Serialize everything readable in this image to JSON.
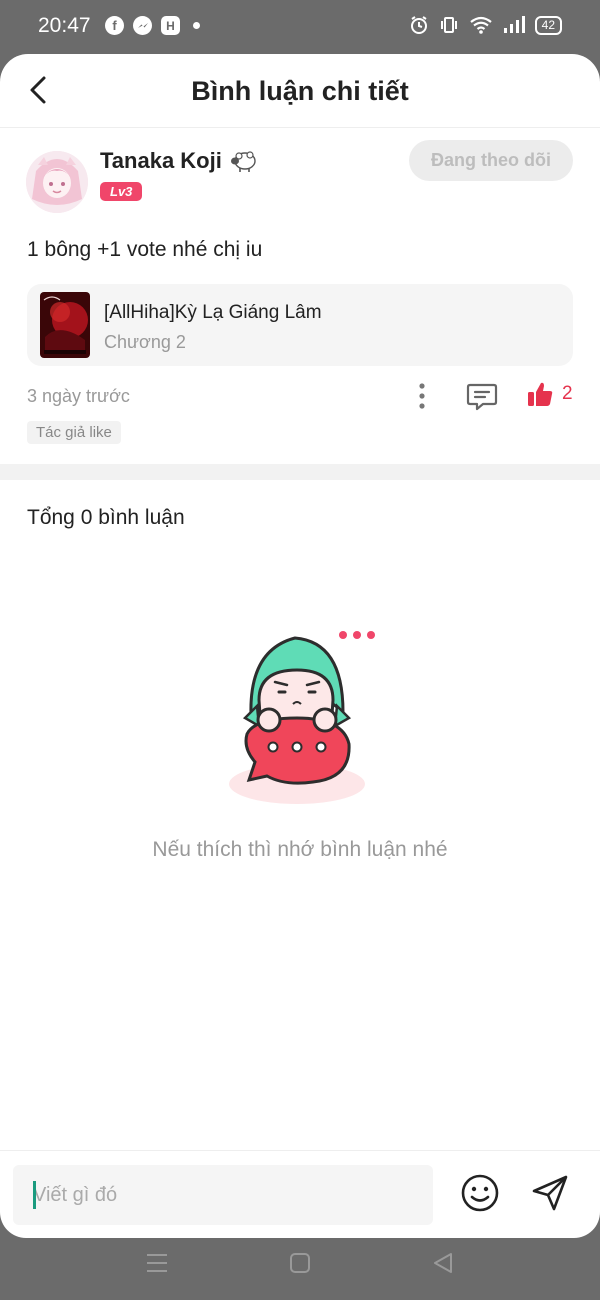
{
  "status_bar": {
    "time": "20:47",
    "battery": "42"
  },
  "header": {
    "title": "Bình luận chi tiết"
  },
  "comment": {
    "user_name": "Tanaka Koji",
    "level": "Lv3",
    "follow_label": "Đang theo dõi",
    "text": "1 bông +1 vote nhé chị iu",
    "book": {
      "title": "[AllHiha]Kỳ Lạ Giáng Lâm",
      "chapter": "Chương 2"
    },
    "time_ago": "3 ngày trước",
    "like_count": "2",
    "author_like_tag": "Tác giả like"
  },
  "comments_section": {
    "total_label": "Tổng 0 bình luận",
    "empty_text": "Nếu thích thì nhớ bình luận nhé"
  },
  "input": {
    "placeholder": "Viết gì đó"
  },
  "colors": {
    "accent": "#f0466a",
    "like": "#e5334d",
    "cursor": "#1a9b7f"
  }
}
